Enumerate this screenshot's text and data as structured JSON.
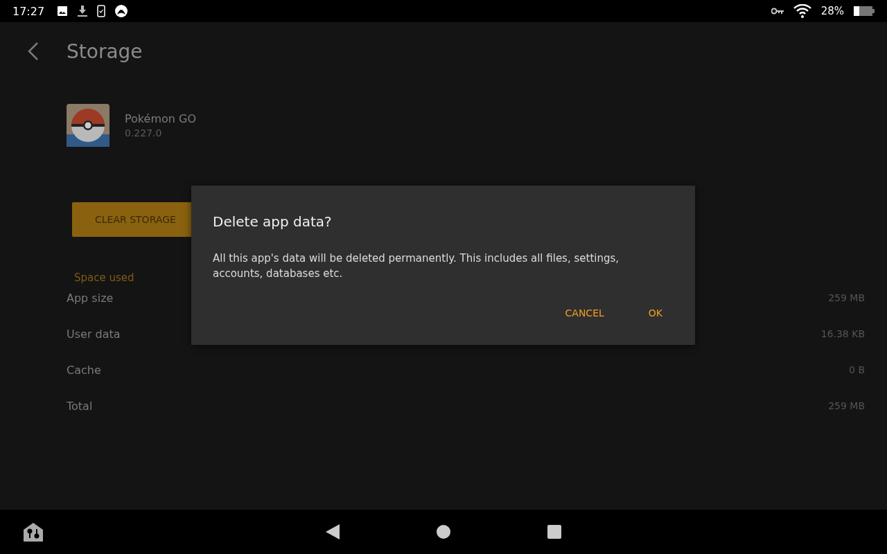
{
  "status_bar": {
    "time": "17:27",
    "battery": "28%"
  },
  "header": {
    "title": "Storage"
  },
  "app": {
    "name": "Pokémon GO",
    "version": "0.227.0"
  },
  "clear_button": {
    "label": "CLEAR STORAGE"
  },
  "section": {
    "title": "Space used"
  },
  "rows": [
    {
      "label": "App size",
      "value": "259 MB"
    },
    {
      "label": "User data",
      "value": "16.38 KB"
    },
    {
      "label": "Cache",
      "value": "0 B"
    },
    {
      "label": "Total",
      "value": "259 MB"
    }
  ],
  "dialog": {
    "title": "Delete app data?",
    "message": "All this app's data will be deleted permanently. This includes all files, settings, accounts, databases etc.",
    "buttons": [
      "CANCEL",
      "OK"
    ]
  }
}
